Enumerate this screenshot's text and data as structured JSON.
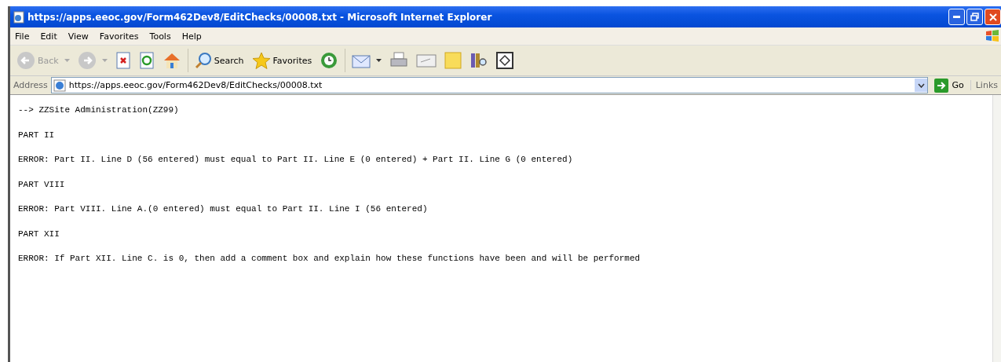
{
  "window": {
    "title": "https://apps.eeoc.gov/Form462Dev8/EditChecks/00008.txt - Microsoft Internet Explorer"
  },
  "menu": [
    "File",
    "Edit",
    "View",
    "Favorites",
    "Tools",
    "Help"
  ],
  "toolbar": [
    {
      "kind": "back",
      "label": "Back",
      "disabled": true
    },
    {
      "kind": "forward",
      "disabled": true
    },
    {
      "kind": "stop"
    },
    {
      "kind": "refresh"
    },
    {
      "kind": "home"
    },
    {
      "kind": "search",
      "label": "Search"
    },
    {
      "kind": "favorites",
      "label": "Favorites"
    },
    {
      "kind": "history"
    },
    {
      "kind": "mail"
    },
    {
      "kind": "print"
    },
    {
      "kind": "edit"
    },
    {
      "kind": "note"
    },
    {
      "kind": "research"
    },
    {
      "kind": "diamond"
    }
  ],
  "address": {
    "label": "Address",
    "value": "https://apps.eeoc.gov/Form462Dev8/EditChecks/00008.txt",
    "go": "Go",
    "links": "Links"
  },
  "content": [
    "--> ZZSite Administration(ZZ99)",
    "PART II",
    "ERROR: Part II. Line D (56 entered) must equal to Part II. Line E (0 entered) + Part II. Line G (0 entered)",
    "PART VIII",
    "ERROR: Part VIII. Line A.(0 entered) must equal to Part II. Line I (56 entered)",
    "PART XII",
    "ERROR: If Part XII. Line C. is 0, then add a comment box and explain how these functions have been and will be performed"
  ]
}
